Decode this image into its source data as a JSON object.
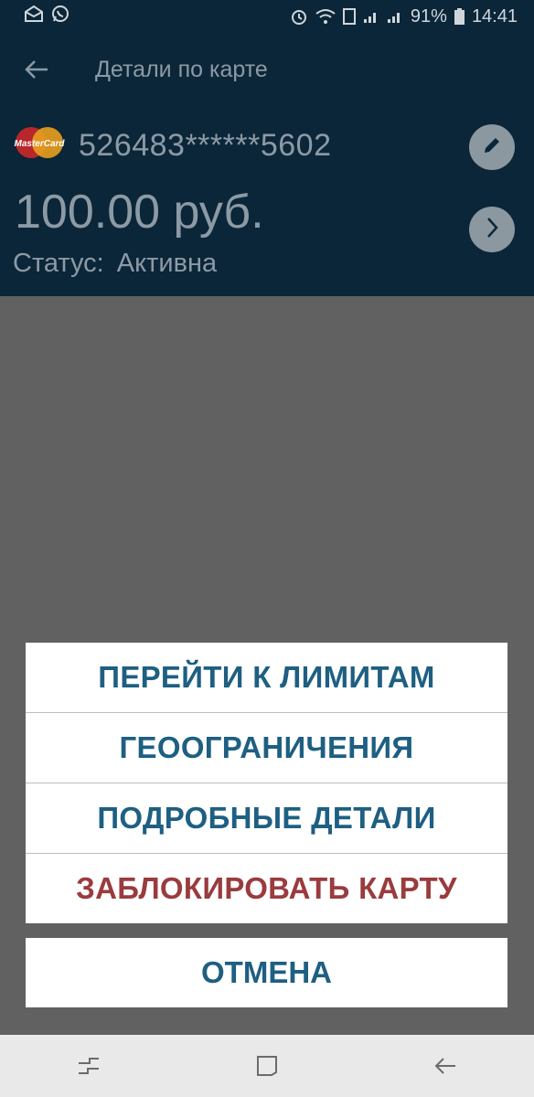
{
  "status_bar": {
    "battery": "91%",
    "time": "14:41",
    "icons": [
      "mail-icon",
      "whatsapp-icon",
      "alarm-icon",
      "wifi-icon",
      "sim-icon",
      "signal-icon",
      "signal-icon",
      "battery-icon"
    ]
  },
  "header": {
    "title": "Детали по карте",
    "back_icon": "back-arrow-icon"
  },
  "card": {
    "brand_logo_text": "MasterCard",
    "number": "526483******5602",
    "amount": "100.00 руб.",
    "status_label": "Статус:",
    "status_value": "Активна",
    "edit_icon": "pencil-icon",
    "next_icon": "chevron-right-icon"
  },
  "action_sheet": {
    "items": [
      {
        "label": "ПЕРЕЙТИ К ЛИМИТАМ",
        "color": "#1e5f82"
      },
      {
        "label": "ГЕООГРАНИЧЕНИЯ",
        "color": "#1e5f82"
      },
      {
        "label": "ПОДРОБНЫЕ ДЕТАЛИ",
        "color": "#1e5f82"
      },
      {
        "label": "ЗАБЛОКИРОВАТЬ КАРТУ",
        "color": "#9a3b3e"
      }
    ],
    "cancel_label": "ОТМЕНА"
  },
  "nav_bar": {
    "icons": [
      "recent-apps-icon",
      "home-icon",
      "back-icon"
    ]
  },
  "colors": {
    "header_bg": "#0b2638",
    "overlay": "#616161",
    "accent": "#1e5f82",
    "danger": "#9a3b3e"
  }
}
